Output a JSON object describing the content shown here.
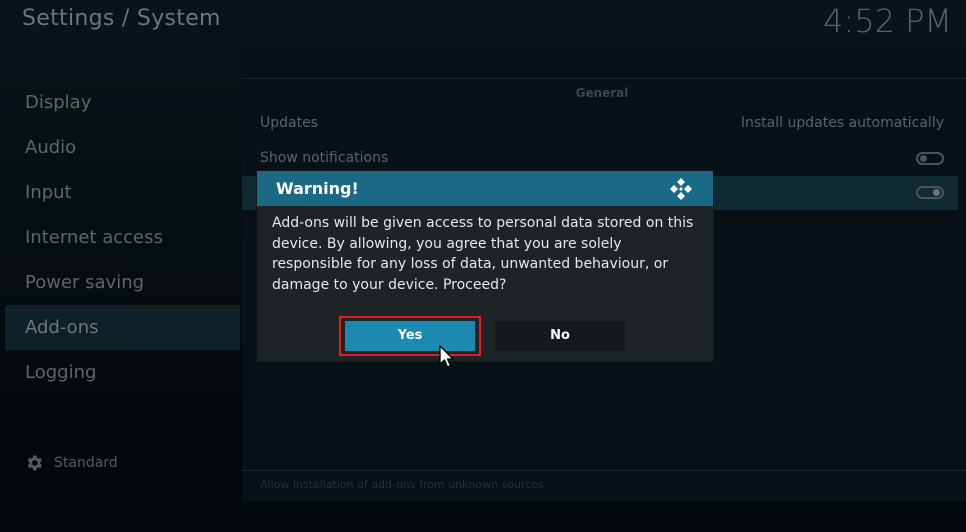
{
  "header": {
    "title": "Settings / System",
    "clock": "4:52 PM"
  },
  "sidebar": {
    "items": [
      {
        "label": "Display"
      },
      {
        "label": "Audio"
      },
      {
        "label": "Input"
      },
      {
        "label": "Internet access"
      },
      {
        "label": "Power saving"
      },
      {
        "label": "Add-ons",
        "active": true
      },
      {
        "label": "Logging"
      }
    ],
    "level_label": "Standard",
    "level_icon": "gear-icon"
  },
  "content": {
    "section_title": "General",
    "rows": [
      {
        "label": "Updates",
        "value": "Install updates automatically"
      },
      {
        "label": "Show notifications",
        "toggle": false
      },
      {
        "label": "",
        "toggle": true,
        "highlighted": true
      }
    ],
    "hint": "Allow installation of add-ons from unknown sources"
  },
  "dialog": {
    "title": "Warning!",
    "icon": "kodi-logo-icon",
    "message": "Add-ons will be given access to personal data stored on this device. By allowing, you agree that you are solely responsible for any loss of data, unwanted behaviour, or damage to your device. Proceed?",
    "yes_label": "Yes",
    "no_label": "No"
  },
  "colors": {
    "accent": "#1b89b0",
    "dialog_header": "#1a6a86",
    "focus_ring": "#e11d1d"
  }
}
